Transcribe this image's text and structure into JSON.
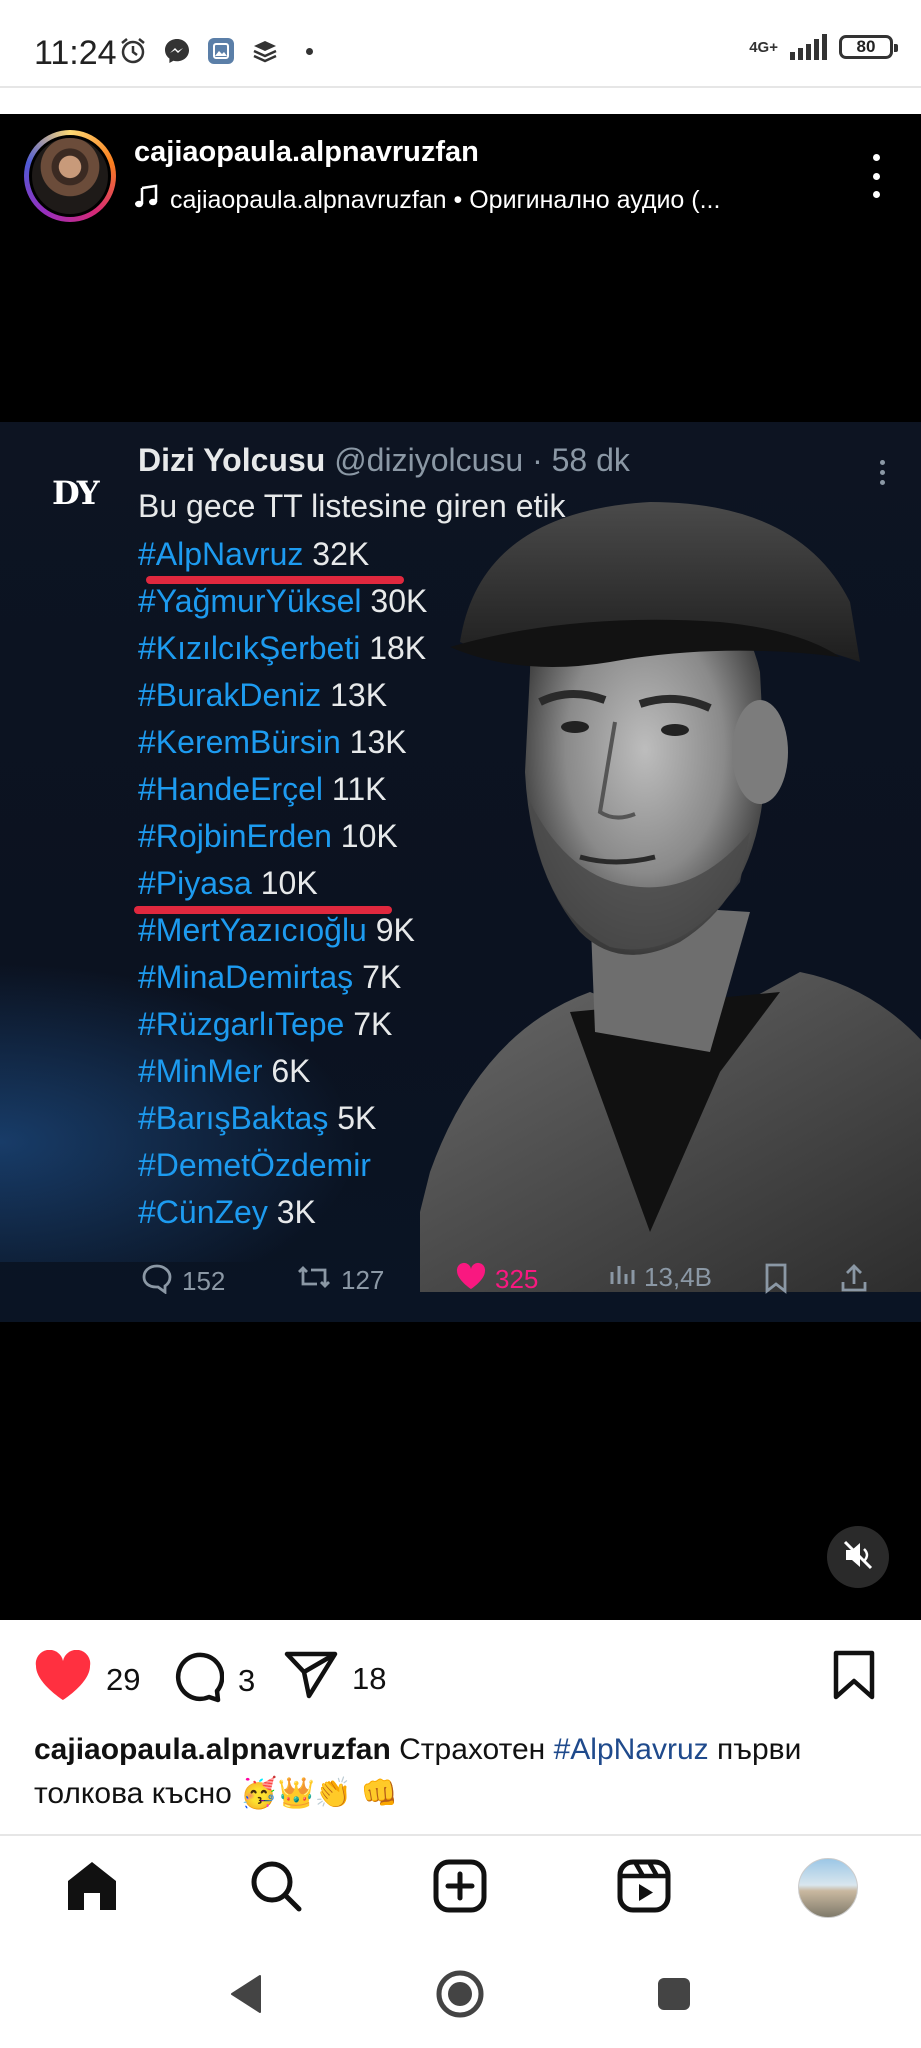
{
  "status_bar": {
    "time": "11:24",
    "network": "4G+",
    "battery": "80",
    "icons": [
      "alarm-icon",
      "messenger-icon",
      "gallery-icon",
      "layers-icon",
      "dot-icon"
    ]
  },
  "post": {
    "username": "cajiaopaula.alpnavruzfan",
    "audio": "cajiaopaula.alpnavruzfan • Оригинално аудио (...",
    "tweet": {
      "logo": "DY",
      "name": "Dizi Yolcusu",
      "handle": "@diziyolcusu · 58 dk",
      "intro": "Bu gece TT listesine giren etik",
      "tags": [
        {
          "tag": "#AlpNavruz",
          "count": "32K"
        },
        {
          "tag": "#YağmurYüksel",
          "count": "30K"
        },
        {
          "tag": "#KızılcıkŞerbeti",
          "count": "18K"
        },
        {
          "tag": "#BurakDeniz",
          "count": "13K"
        },
        {
          "tag": "#KeremBürsin",
          "count": "13K"
        },
        {
          "tag": "#HandeErçel",
          "count": "11K"
        },
        {
          "tag": "#RojbinErden",
          "count": "10K"
        },
        {
          "tag": "#Piyasa",
          "count": "10K"
        },
        {
          "tag": "#MertYazıcıoğlu",
          "count": "9K"
        },
        {
          "tag": "#MinaDemirtaş",
          "count": "7K"
        },
        {
          "tag": "#RüzgarlıTepe",
          "count": "7K"
        },
        {
          "tag": "#MinMer",
          "count": "6K"
        },
        {
          "tag": "#BarışBaktaş",
          "count": "5K"
        },
        {
          "tag": "#DemetÖzdemir",
          "count": ""
        },
        {
          "tag": "#CünZey",
          "count": "3K"
        }
      ],
      "replies": "152",
      "retweets": "127",
      "likes": "325",
      "views": "13,4B"
    }
  },
  "actions": {
    "likes": "29",
    "comments": "3",
    "shares": "18"
  },
  "caption": {
    "username": "cajiaopaula.alpnavruzfan",
    "text_before": " Страхотен ",
    "hashtag": "#AlpNavruz",
    "text_after": " първи толкова късно 🥳👑👏 👊"
  },
  "colors": {
    "like_red": "#ff3040",
    "link_blue": "#1d9bf0",
    "underline_red": "#e0283e"
  }
}
